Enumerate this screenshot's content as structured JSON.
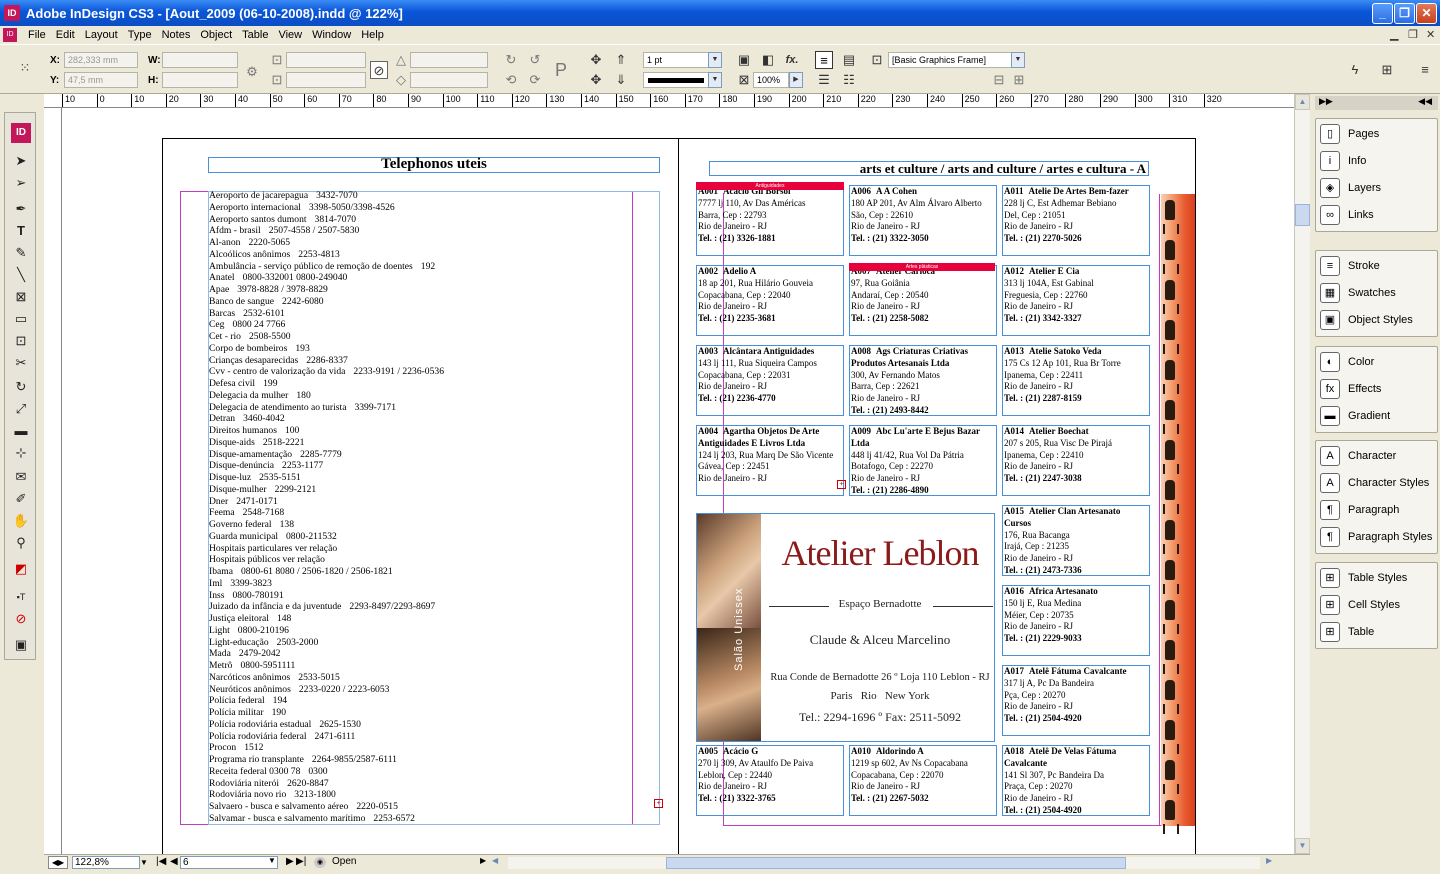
{
  "window": {
    "title": "Adobe InDesign CS3 - [Aout_2009 (06-10-2008).indd @ 122%]"
  },
  "menu": [
    "File",
    "Edit",
    "Layout",
    "Type",
    "Notes",
    "Object",
    "Table",
    "View",
    "Window",
    "Help"
  ],
  "control": {
    "x_label": "X:",
    "x_value": "282,333 mm",
    "y_label": "Y:",
    "y_value": "47,5 mm",
    "w_label": "W:",
    "h_label": "H:",
    "stroke_weight": "1 pt",
    "scale_percent": "100%",
    "object_style": "[Basic Graphics Frame]"
  },
  "ruler": [
    "10",
    "0",
    "10",
    "20",
    "30",
    "40",
    "50",
    "60",
    "70",
    "80",
    "90",
    "100",
    "110",
    "120",
    "130",
    "140",
    "150",
    "160",
    "170",
    "180",
    "190",
    "200",
    "210",
    "220",
    "230",
    "240",
    "250",
    "260",
    "270",
    "280",
    "290",
    "300",
    "310",
    "320"
  ],
  "left_page": {
    "title": "Telephonos uteis",
    "entries": [
      [
        "Aeroporto de jacarepagua",
        "3432-7070"
      ],
      [
        "Aeroporto internacional",
        "3398-5050/3398-4526"
      ],
      [
        "Aeroporto santos dumont",
        "3814-7070"
      ],
      [
        "Afdm - brasil",
        "2507-4558 / 2507-5830"
      ],
      [
        "Al-anon",
        "2220-5065"
      ],
      [
        "Alcoólicos anônimos",
        "2253-4813"
      ],
      [
        "Ambulância - serviço público de remoção de doentes",
        "192"
      ],
      [
        "Anatel",
        "0800-332001 0800-249040"
      ],
      [
        "Apae",
        "3978-8828 / 3978-8829"
      ],
      [
        "Banco de sangue",
        "2242-6080"
      ],
      [
        "Barcas",
        "2532-6101"
      ],
      [
        "Ceg",
        "0800 24 7766"
      ],
      [
        "Cet - rio",
        "2508-5500"
      ],
      [
        "Corpo de bombeiros",
        "193"
      ],
      [
        "Crianças desaparecidas",
        "2286-8337"
      ],
      [
        "Cvv - centro de valorização da vida",
        "2233-9191 / 2236-0536"
      ],
      [
        "Defesa civil",
        "199"
      ],
      [
        "Delegacia da mulher",
        "180"
      ],
      [
        "Delegacia de atendimento ao turista",
        "3399-7171"
      ],
      [
        "Detran",
        "3460-4042"
      ],
      [
        "Direitos humanos",
        "100"
      ],
      [
        "Disque-aids",
        "2518-2221"
      ],
      [
        "Disque-amamentação",
        "2285-7779"
      ],
      [
        "Disque-denúncia",
        "2253-1177"
      ],
      [
        "Disque-luz",
        "2535-5151"
      ],
      [
        "Disque-mulher",
        "2299-2121"
      ],
      [
        "Dner",
        "2471-0171"
      ],
      [
        "Feema",
        "2548-7168"
      ],
      [
        "Governo federal",
        "138"
      ],
      [
        "Guarda municipal",
        "0800-211532"
      ],
      [
        "Hospitais particulares ver relação",
        ""
      ],
      [
        "Hospitais públicos ver relação",
        ""
      ],
      [
        "Ibama",
        "0800-61 8080 / 2506-1820 / 2506-1821"
      ],
      [
        "Iml",
        "3399-3823"
      ],
      [
        "Inss",
        "0800-780191"
      ],
      [
        "Juizado da infância e da juventude",
        "2293-8497/2293-8697"
      ],
      [
        "Justiça eleitoral",
        "148"
      ],
      [
        "Light",
        "0800-210196"
      ],
      [
        "Light-educação",
        "2503-2000"
      ],
      [
        "Mada",
        "2479-2042"
      ],
      [
        "Metrô",
        "0800-5951111"
      ],
      [
        "Narcóticos anônimos",
        "2533-5015"
      ],
      [
        "Neuróticos anônimos",
        "2233-0220 / 2223-6053"
      ],
      [
        "Polícia federal",
        "194"
      ],
      [
        "Polícia militar",
        "190"
      ],
      [
        "Polícia rodoviária estadual",
        "2625-1530"
      ],
      [
        "Polícia rodoviária federal",
        "2471-6111"
      ],
      [
        "Procon",
        "1512"
      ],
      [
        "Programa rio transplante",
        "2264-9855/2587-6111"
      ],
      [
        "Receita federal 0300 78",
        "0300"
      ],
      [
        "Rodoviária niterói",
        "2620-8847"
      ],
      [
        "Rodoviária novo rio",
        "3213-1800"
      ],
      [
        "Salvaero - busca e salvamento aéreo",
        "2220-0515"
      ],
      [
        "Salvamar - busca e salvamento marítimo",
        "2253-6572"
      ]
    ]
  },
  "right_page": {
    "title": "arts et culture / arts and culture / artes e cultura  -  A",
    "bar_label_1": "Antiguidades",
    "bar_label_2": "Artes plásticas",
    "cards": [
      {
        "code": "A001",
        "name": "Acácio Gil Borsoi",
        "lines": [
          "7777 lj 110, Av Das Américas",
          "Barra, Cep : 22793",
          "Rio de Janeiro - RJ"
        ],
        "tel": "Tel. : (21) 3326-1881"
      },
      {
        "code": "A006",
        "name": "A A Cohen",
        "lines": [
          "180 AP 201, Av Alm Álvaro Alberto",
          "São, Cep : 22610",
          "Rio de Janeiro - RJ"
        ],
        "tel": "Tel. : (21) 3322-3050"
      },
      {
        "code": "A011",
        "name": "Atelie De Artes Bem-fazer",
        "lines": [
          "228 lj C, Est Adhemar Bebiano",
          "Del, Cep : 21051",
          "Rio de Janeiro - RJ"
        ],
        "tel": "Tel. : (21) 2270-5026"
      },
      {
        "code": "A002",
        "name": "Adelio A",
        "lines": [
          "18 ap 201, Rua Hilário Gouveia",
          "Copacabana, Cep : 22040",
          "Rio de Janeiro - RJ"
        ],
        "tel": "Tel. : (21) 2235-3681"
      },
      {
        "code": "A007",
        "name": "Atelier Carioca",
        "lines": [
          "97, Rua Goiânia",
          "Andaraí, Cep : 20540",
          "Rio de Janeiro - RJ"
        ],
        "tel": "Tel. : (21) 2258-5082"
      },
      {
        "code": "A012",
        "name": "Atelier E Cia",
        "lines": [
          "313 lj 104A, Est Gabinal",
          "Freguesia, Cep : 22760",
          "Rio de Janeiro - RJ"
        ],
        "tel": "Tel. : (21) 3342-3327"
      },
      {
        "code": "A003",
        "name": "Alcântara Antiguidades",
        "lines": [
          "143 lj 111, Rua Siqueira Campos",
          "Copacabana, Cep : 22031",
          "Rio de Janeiro - RJ"
        ],
        "tel": "Tel. : (21) 2236-4770"
      },
      {
        "code": "A008",
        "name": "Ags Criaturas Criativas Produtos Artesanais Ltda",
        "lines": [
          "300, Av Fernando Matos",
          "Barra, Cep : 22621",
          "Rio de Janeiro - RJ"
        ],
        "tel": "Tel. : (21) 2493-8442"
      },
      {
        "code": "A013",
        "name": "Atelie Satoko Veda",
        "lines": [
          "175 Cs 12 Ap 101, Rua Br Torre",
          "Ipanema, Cep : 22411",
          "Rio de Janeiro - RJ"
        ],
        "tel": "Tel. : (21) 2287-8159"
      },
      {
        "code": "A004",
        "name": "Agartha Objetos De Arte Antiguidades E Livros Ltda",
        "lines": [
          "124 lj 203, Rua Marq De São Vicente",
          "Gávea, Cep : 22451",
          "Rio de Janeiro - RJ"
        ],
        "tel": ""
      },
      {
        "code": "A009",
        "name": "Abc Lu'arte E Bejus Bazar Ltda",
        "lines": [
          "448 lj 41/42, Rua Vol Da Pátria",
          "Botafogo, Cep : 22270",
          "Rio de Janeiro - RJ"
        ],
        "tel": "Tel. : (21) 2286-4890"
      },
      {
        "code": "A014",
        "name": "Atelier Boechat",
        "lines": [
          "207 s 205, Rua Visc De Pirajá",
          "Ipanema, Cep : 22410",
          "Rio de Janeiro - RJ"
        ],
        "tel": "Tel. : (21) 2247-3038"
      },
      {
        "code": "A015",
        "name": "Atelier Clan Artesanato Cursos",
        "lines": [
          "176, Rua Bacanga",
          "Irajá, Cep : 21235",
          "Rio de Janeiro - RJ"
        ],
        "tel": "Tel. : (21) 2473-7336"
      },
      {
        "code": "A016",
        "name": "Africa Artesanato",
        "lines": [
          "150 lj E, Rua Medina",
          "Méier, Cep : 20735",
          "Rio de Janeiro - RJ"
        ],
        "tel": "Tel. : (21) 2229-9033"
      },
      {
        "code": "A017",
        "name": "Atelê Fátuma Cavalcante",
        "lines": [
          "317 lj A, Pc Da Bandeira",
          "Pça, Cep : 20270",
          "Rio de Janeiro - RJ"
        ],
        "tel": "Tel. : (21) 2504-4920"
      },
      {
        "code": "A005",
        "name": "Acácio G",
        "lines": [
          "270 lj 309, Av Ataulfo De Paiva",
          "Leblon, Cep : 22440",
          "Rio de Janeiro - RJ"
        ],
        "tel": "Tel. : (21) 3322-3765"
      },
      {
        "code": "A010",
        "name": "Aldorindo A",
        "lines": [
          "1219 sp 602, Av Ns Copacabana",
          "Copacabana, Cep : 22070",
          "Rio de Janeiro - RJ"
        ],
        "tel": "Tel. : (21) 2267-5032"
      },
      {
        "code": "A018",
        "name": "Atelê De Velas Fátuma Cavalcante",
        "lines": [
          "141 Sl 307, Pc Bandeira Da",
          "Praça, Cep : 20270",
          "Rio de Janeiro - RJ"
        ],
        "tel": "Tel. : (21) 2504-4920"
      }
    ],
    "ad": {
      "brand": "Atelier Leblon",
      "sub": "Espaço Bernadotte",
      "names": "Claude & Alceu Marcelino",
      "address": "Rua Conde de Bernadotte 26 º Loja 110 Leblon - RJ",
      "cities": "Paris   Rio   New York",
      "phones": "Tel.: 2294-1696 º Fax: 2511-5092",
      "side": "Salão Unissex"
    }
  },
  "statusbar": {
    "zoom": "122,8%",
    "page": "6",
    "open_label": "Open"
  },
  "panels": [
    [
      "Pages",
      "pages-icon",
      "▯"
    ],
    [
      "Info",
      "info-icon",
      "i"
    ],
    [
      "Layers",
      "layers-icon",
      "◈"
    ],
    [
      "Links",
      "links-icon",
      "∞"
    ],
    [
      "Stroke",
      "stroke-icon",
      "≡"
    ],
    [
      "Swatches",
      "swatches-icon",
      "▦"
    ],
    [
      "Object Styles",
      "object-styles-icon",
      "▣"
    ],
    [
      "Color",
      "color-icon",
      "◐"
    ],
    [
      "Effects",
      "effects-icon",
      "fx"
    ],
    [
      "Gradient",
      "gradient-icon",
      "▬"
    ],
    [
      "Character",
      "character-icon",
      "A"
    ],
    [
      "Character Styles",
      "character-styles-icon",
      "A"
    ],
    [
      "Paragraph",
      "paragraph-icon",
      "¶"
    ],
    [
      "Paragraph Styles",
      "paragraph-styles-icon",
      "¶"
    ],
    [
      "Table Styles",
      "table-styles-icon",
      "⊞"
    ],
    [
      "Cell Styles",
      "cell-styles-icon",
      "⊞"
    ],
    [
      "Table",
      "table-icon",
      "⊞"
    ]
  ],
  "colors": {
    "accent": "#0a55d8",
    "guide_magenta": "#c03cc0",
    "frame_blue": "#4a90d9",
    "red_bar": "#e8003c",
    "ad_red": "#8b1a1a"
  }
}
